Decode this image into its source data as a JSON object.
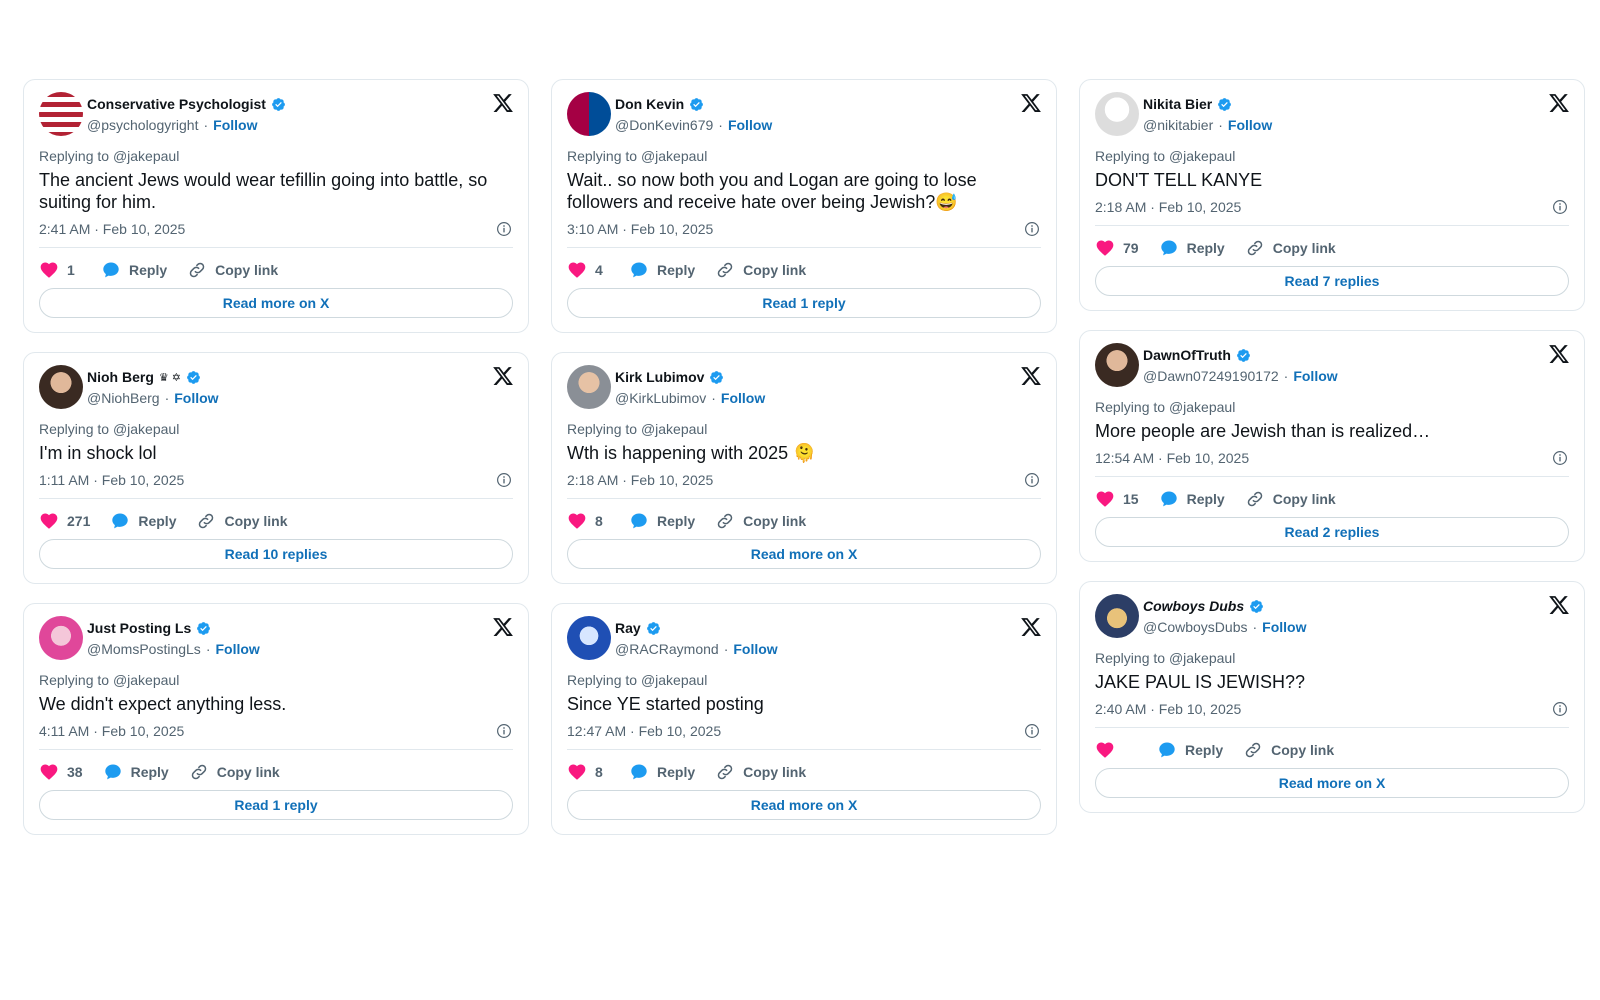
{
  "colors": {
    "accent": "#1170b8",
    "heart": "#f91880",
    "verified": "#1d9bf0",
    "secondary_text": "#536471"
  },
  "common": {
    "follow": "Follow",
    "reply": "Reply",
    "copy_link": "Copy link",
    "replying_to": "Replying to",
    "replying_handle": "@jakepaul",
    "separator": "·"
  },
  "tweets": [
    {
      "name": "Conservative Psychologist",
      "handle": "@psychologyright",
      "text": "The ancient Jews would wear tefillin going into battle, so suiting for him.",
      "timestamp": "2:41 AM · Feb 10, 2025",
      "likes": "1",
      "cta": "Read more on X",
      "avatar_icon": "us-flag-avatar"
    },
    {
      "name": "Don Kevin",
      "handle": "@DonKevin679",
      "text": "Wait.. so now both you and Logan are going to lose followers and receive hate over being Jewish?😅",
      "timestamp": "3:10 AM · Feb 10, 2025",
      "likes": "4",
      "cta": "Read 1 reply",
      "avatar_icon": "fc-barcelona-crest-avatar"
    },
    {
      "name": "Nikita Bier",
      "handle": "@nikitabier",
      "text": "DON'T TELL KANYE",
      "timestamp": "2:18 AM · Feb 10, 2025",
      "likes": "79",
      "cta": "Read 7 replies",
      "avatar_icon": "sketch-portrait-avatar"
    },
    {
      "name": "Nioh Berg",
      "name_emblems": "♛ ✡",
      "handle": "@NiohBerg",
      "text": "I'm in shock lol",
      "timestamp": "1:11 AM · Feb 10, 2025",
      "likes": "271",
      "cta": "Read 10 replies",
      "avatar_icon": "woman-portrait-avatar"
    },
    {
      "name": "Kirk Lubimov",
      "handle": "@KirkLubimov",
      "text": "Wth is happening with 2025 🫠",
      "timestamp": "2:18 AM · Feb 10, 2025",
      "likes": "8",
      "cta": "Read more on X",
      "avatar_icon": "man-portrait-avatar"
    },
    {
      "name": "DawnOfTruth",
      "handle": "@Dawn07249190172",
      "text": "More people are Jewish than is realized…",
      "timestamp": "12:54 AM · Feb 10, 2025",
      "likes": "15",
      "cta": "Read 2 replies",
      "avatar_icon": "woman-portrait-avatar"
    },
    {
      "name": "Just Posting Ls",
      "handle": "@MomsPostingLs",
      "text": "We didn't expect anything less.",
      "timestamp": "4:11 AM · Feb 10, 2025",
      "likes": "38",
      "cta": "Read 1 reply",
      "avatar_icon": "pink-cartoon-avatar"
    },
    {
      "name": "Ray",
      "handle": "@RACRaymond",
      "text": "Since YE started posting",
      "timestamp": "12:47 AM · Feb 10, 2025",
      "likes": "8",
      "cta": "Read more on X",
      "avatar_icon": "blue-cartoon-avatar"
    },
    {
      "name": "Cowboys Dubs",
      "handle": "@CowboysDubs",
      "text": "JAKE PAUL IS JEWISH??",
      "timestamp": "2:40 AM · Feb 10, 2025",
      "likes": "",
      "cta": "Read more on X",
      "avatar_icon": "cowboy-cartoon-avatar"
    }
  ]
}
